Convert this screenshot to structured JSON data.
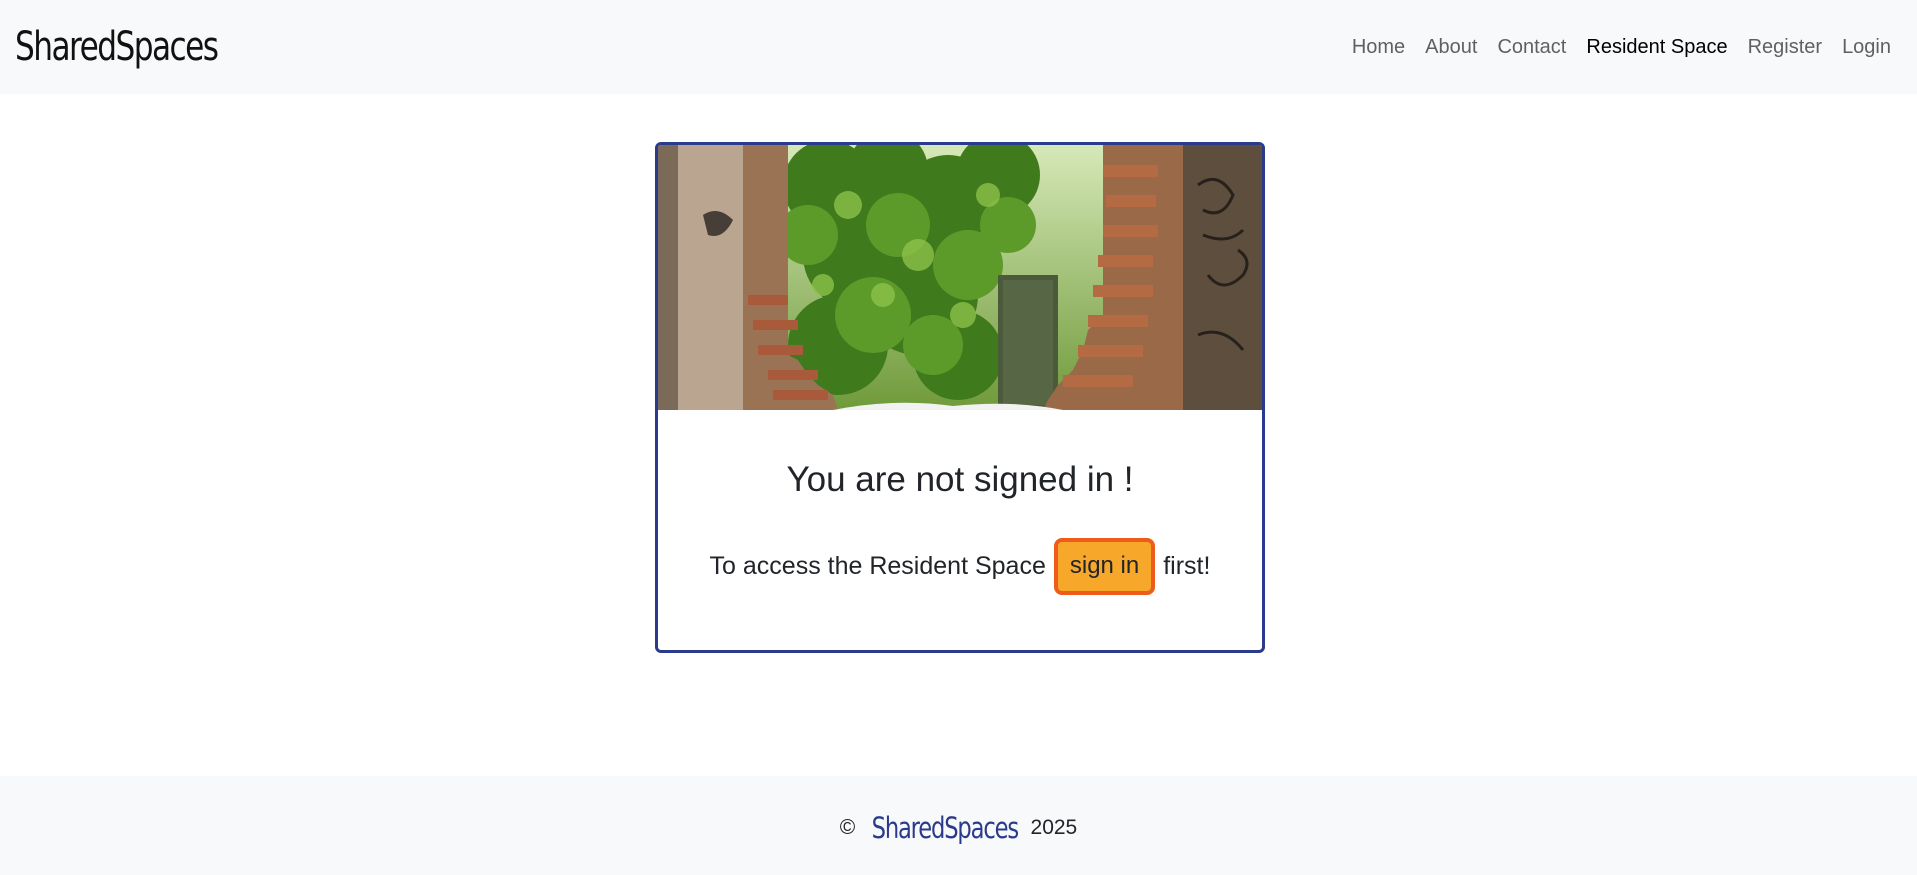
{
  "navbar": {
    "brand": "SharedSpaces",
    "links": [
      "Home",
      "About",
      "Contact",
      "Resident Space",
      "Register",
      "Login"
    ],
    "active_index": 3
  },
  "card": {
    "title": "You are not signed in !",
    "text_before": "To access the Resident Space",
    "button_label": "sign in",
    "text_after": "first!"
  },
  "footer": {
    "copyright_symbol": "©",
    "brand": "SharedSpaces",
    "year": "2025"
  },
  "colors": {
    "accent": "#2b3b8c",
    "button_bg": "#f7a82b",
    "button_border": "#ef5b1b",
    "navbar_bg": "#f8f9fa"
  }
}
